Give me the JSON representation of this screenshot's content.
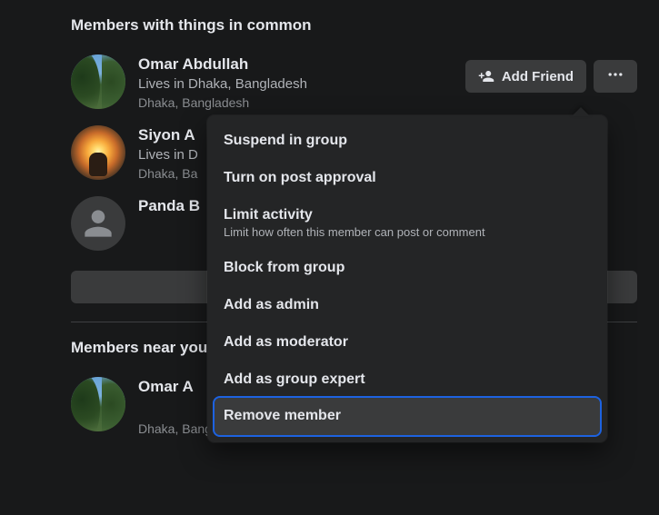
{
  "sections": {
    "common": {
      "heading": "Members with things in common"
    },
    "near": {
      "heading": "Members near you"
    }
  },
  "buttons": {
    "add_friend": "Add Friend"
  },
  "members_common": [
    {
      "name": "Omar Abdullah",
      "sub": "Lives in Dhaka, Bangladesh",
      "sub2": "Dhaka, Bangladesh"
    },
    {
      "name": "Siyon A",
      "sub": "Lives in D",
      "sub2": "Dhaka, Ba"
    },
    {
      "name": "Panda B",
      "sub": "",
      "sub2": ""
    }
  ],
  "members_near": [
    {
      "name": "Omar A",
      "sub": "",
      "sub2": "Dhaka, Bangladesh"
    }
  ],
  "menu": {
    "items": [
      {
        "label": "Suspend in group"
      },
      {
        "label": "Turn on post approval"
      },
      {
        "label": "Limit activity",
        "sub": "Limit how often this member can post or comment"
      },
      {
        "label": "Block from group"
      },
      {
        "label": "Add as admin"
      },
      {
        "label": "Add as moderator"
      },
      {
        "label": "Add as group expert"
      },
      {
        "label": "Remove member"
      }
    ]
  }
}
